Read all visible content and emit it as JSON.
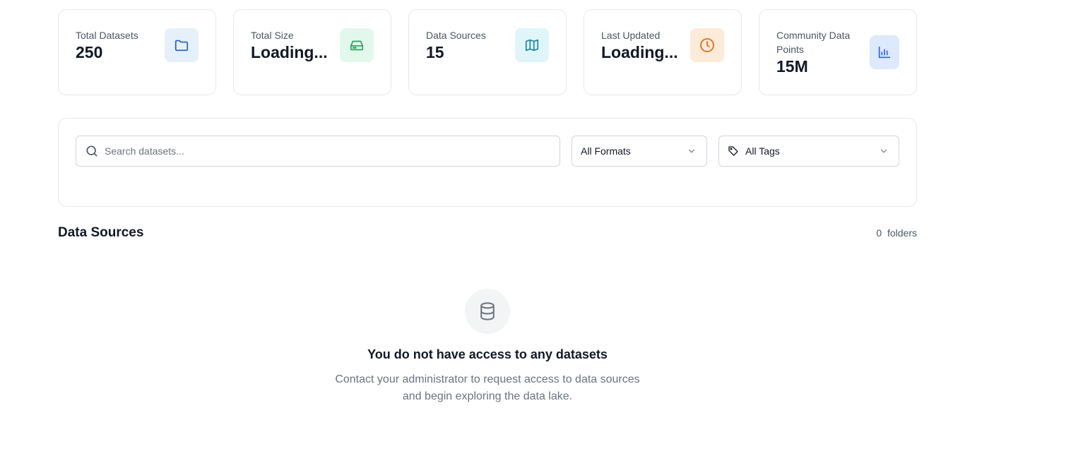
{
  "stats": [
    {
      "label": "Total Datasets",
      "value": "250",
      "icon": "folder-icon",
      "icon_bg": "#e6f0fb",
      "icon_color": "#1d5fb8"
    },
    {
      "label": "Total Size",
      "value": "Loading...",
      "icon": "hard-drive-icon",
      "icon_bg": "#e3f8ec",
      "icon_color": "#22a55b"
    },
    {
      "label": "Data Sources",
      "value": "15",
      "icon": "map-icon",
      "icon_bg": "#e0f5fa",
      "icon_color": "#1a86a1"
    },
    {
      "label": "Last Updated",
      "value": "Loading...",
      "icon": "clock-icon",
      "icon_bg": "#fdebd9",
      "icon_color": "#ea6a1d"
    },
    {
      "label": "Community Data Points",
      "value": "15M",
      "icon": "bar-chart-icon",
      "icon_bg": "#dde9fc",
      "icon_color": "#2563eb"
    }
  ],
  "filters": {
    "search_placeholder": "Search datasets...",
    "format_selected": "All Formats",
    "tags_selected": "All Tags"
  },
  "section": {
    "title": "Data Sources",
    "count": "0",
    "count_unit": "folders"
  },
  "empty_state": {
    "icon": "database-icon",
    "title": "You do not have access to any datasets",
    "description": "Contact your administrator to request access to data sources and begin exploring the data lake."
  }
}
